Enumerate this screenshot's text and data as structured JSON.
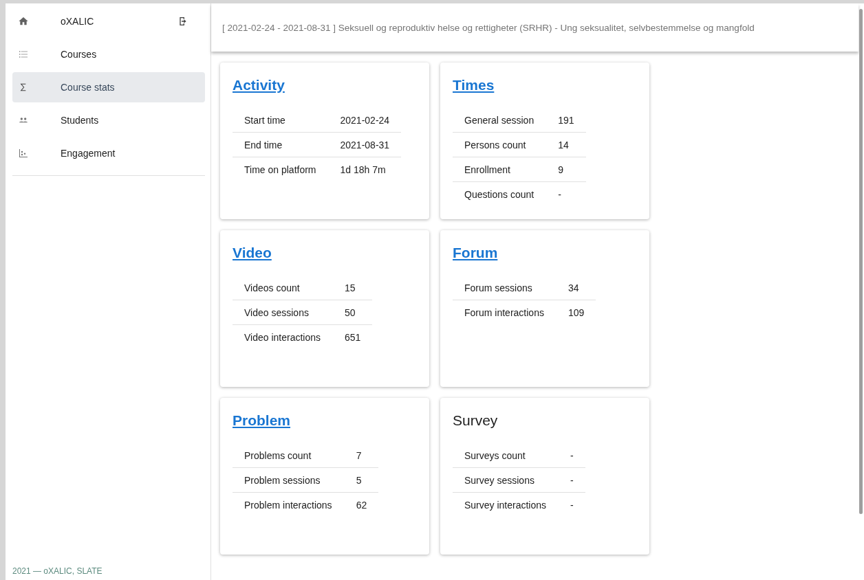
{
  "sidebar": {
    "brand": "oXALIC",
    "items": [
      {
        "label": "Courses",
        "kind": "list",
        "selected": false
      },
      {
        "label": "Course stats",
        "kind": "sigma",
        "selected": true
      },
      {
        "label": "Students",
        "kind": "people",
        "selected": false
      },
      {
        "label": "Engagement",
        "kind": "scatter",
        "selected": false
      }
    ],
    "footer": "2021 — oXALIC, SLATE"
  },
  "header": {
    "title": "[ 2021-02-24 - 2021-08-31 ] Seksuell og reproduktiv helse og rettigheter (SRHR) - Ung seksualitet, selvbestemmelse og mangfold"
  },
  "cards": [
    {
      "title": "Activity",
      "link": true,
      "rows": [
        [
          "Start time",
          "2021-02-24"
        ],
        [
          "End time",
          "2021-08-31"
        ],
        [
          "Time on platform",
          "1d 18h 7m"
        ]
      ]
    },
    {
      "title": "Times",
      "link": true,
      "rows": [
        [
          "General session",
          "191"
        ],
        [
          "Persons count",
          "14"
        ],
        [
          "Enrollment",
          "9"
        ],
        [
          "Questions count",
          "-"
        ]
      ]
    },
    {
      "title": "Video",
      "link": true,
      "rows": [
        [
          "Videos count",
          "15"
        ],
        [
          "Video sessions",
          "50"
        ],
        [
          "Video interactions",
          "651"
        ]
      ]
    },
    {
      "title": "Forum",
      "link": true,
      "rows": [
        [
          "Forum sessions",
          "34"
        ],
        [
          "Forum interactions",
          "109"
        ]
      ]
    },
    {
      "title": "Problem",
      "link": true,
      "rows": [
        [
          "Problems count",
          "7"
        ],
        [
          "Problem sessions",
          "5"
        ],
        [
          "Problem interactions",
          "62"
        ]
      ]
    },
    {
      "title": "Survey",
      "link": false,
      "rows": [
        [
          "Surveys count",
          "-"
        ],
        [
          "Survey sessions",
          "-"
        ],
        [
          "Survey interactions",
          "-"
        ]
      ]
    }
  ]
}
